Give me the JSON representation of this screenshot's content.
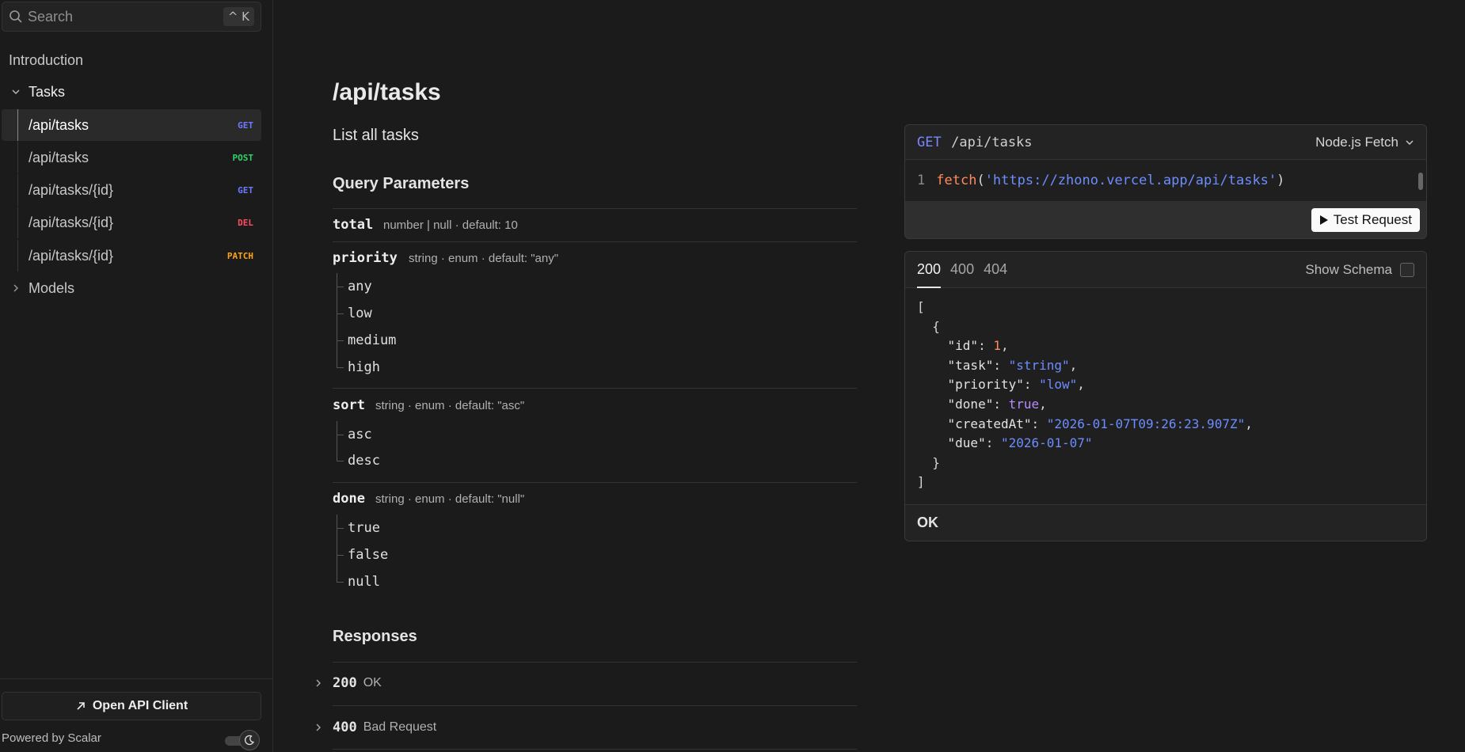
{
  "search": {
    "placeholder": "Search",
    "shortcut": "^ K"
  },
  "sidebar": {
    "intro": "Introduction",
    "tasks_group": "Tasks",
    "endpoints": [
      {
        "path": "/api/tasks",
        "method": "GET",
        "color": "#6b7bff",
        "active": true
      },
      {
        "path": "/api/tasks",
        "method": "POST",
        "color": "#2fd36b",
        "active": false
      },
      {
        "path": "/api/tasks/{id}",
        "method": "GET",
        "color": "#6b7bff",
        "active": false
      },
      {
        "path": "/api/tasks/{id}",
        "method": "DEL",
        "color": "#ff4d5e",
        "active": false
      },
      {
        "path": "/api/tasks/{id}",
        "method": "PATCH",
        "color": "#ffa31a",
        "active": false
      }
    ],
    "models_group": "Models",
    "open_client": "Open API Client",
    "powered": "Powered by Scalar"
  },
  "main": {
    "title": "/api/tasks",
    "summary": "List all tasks",
    "query_heading": "Query Parameters",
    "params": [
      {
        "name": "total",
        "meta": "number | null · default: 10",
        "enum": []
      },
      {
        "name": "priority",
        "meta": "string · enum · default: \"any\"",
        "enum": [
          "any",
          "low",
          "medium",
          "high"
        ]
      },
      {
        "name": "sort",
        "meta": "string · enum · default: \"asc\"",
        "enum": [
          "asc",
          "desc"
        ]
      },
      {
        "name": "done",
        "meta": "string · enum · default: \"null\"",
        "enum": [
          "true",
          "false",
          "null"
        ]
      }
    ],
    "responses_heading": "Responses",
    "responses": [
      {
        "code": "200",
        "desc": "OK"
      },
      {
        "code": "400",
        "desc": "Bad Request"
      }
    ]
  },
  "request": {
    "method": "GET",
    "path": "/api/tasks",
    "language": "Node.js Fetch",
    "line_number": "1",
    "code_fn": "fetch",
    "code_open": "(",
    "code_url": "'https://zhono.vercel.app/api/tasks'",
    "code_close": ")",
    "test_button": "Test Request"
  },
  "response_panel": {
    "tabs": [
      "200",
      "400",
      "404"
    ],
    "active_tab": "200",
    "show_schema": "Show Schema",
    "example": {
      "id": "1",
      "task": "\"string\"",
      "priority": "\"low\"",
      "done": "true",
      "createdAt": "\"2026-01-07T09:26:23.907Z\"",
      "due": "\"2026-01-07\""
    },
    "status_text": "OK"
  }
}
